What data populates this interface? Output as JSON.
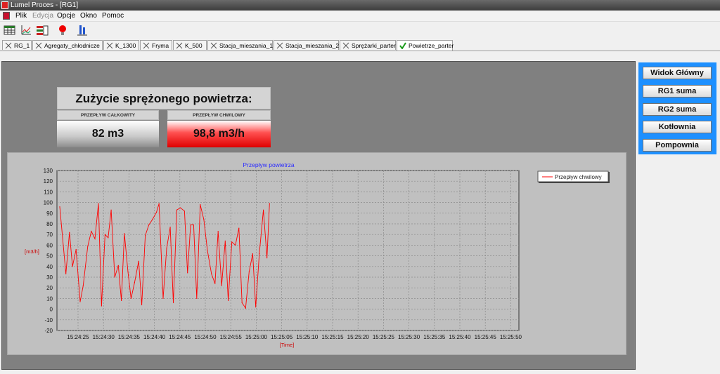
{
  "window": {
    "title": "Lumel Proces - [RG1]"
  },
  "menu": [
    {
      "label": "Plik",
      "disabled": false
    },
    {
      "label": "Edycja",
      "disabled": true
    },
    {
      "label": "Opcje",
      "disabled": false
    },
    {
      "label": "Okno",
      "disabled": false
    },
    {
      "label": "Pomoc",
      "disabled": false
    }
  ],
  "toolbar": [
    "table-icon",
    "chart-icon",
    "list-icon",
    "alarm-lamp-icon",
    "export-icon"
  ],
  "tabs": [
    {
      "label": "RG_1",
      "active": false
    },
    {
      "label": "Agregaty_chłodnicze",
      "active": false
    },
    {
      "label": "K_1300",
      "active": false
    },
    {
      "label": "Fryma",
      "active": false
    },
    {
      "label": "K_500",
      "active": false
    },
    {
      "label": "Stacja_mieszania_1",
      "active": false
    },
    {
      "label": "Stacja_mieszania_2",
      "active": false
    },
    {
      "label": "Sprężarki_parter",
      "active": false
    },
    {
      "label": "Powietrze_parter",
      "active": true
    }
  ],
  "consumption": {
    "title": "Zużycie sprężonego powietrza:",
    "total_label": "PRZEPŁYW CAŁKOWITY",
    "total_value": "82 m3",
    "instant_label": "PRZEPŁYW CHWILOWY",
    "instant_value": "98,8 m3/h",
    "instant_color": "#ff0000"
  },
  "nav_buttons": [
    "Widok Główny",
    "RG1 suma",
    "RG2 suma",
    "Kotłownia",
    "Pompownia"
  ],
  "chart_data": {
    "type": "line",
    "title": "Przepływ powietrza",
    "xlabel": "[Time]",
    "ylabel": "[m3/h]",
    "ylim": [
      -20,
      130
    ],
    "yticks": [
      -20,
      -10,
      0,
      10,
      20,
      30,
      40,
      50,
      60,
      70,
      80,
      90,
      100,
      110,
      120,
      130
    ],
    "xlim_seconds": [
      0,
      60
    ],
    "xticks": [
      "15:24:25",
      "15:24:30",
      "15:24:35",
      "15:24:40",
      "15:24:45",
      "15:24:50",
      "15:24:55",
      "15:25:00",
      "15:25:05",
      "15:25:10",
      "15:25:15",
      "15:25:20",
      "15:25:25",
      "15:25:30",
      "15:25:35",
      "15:25:40",
      "15:25:45",
      "15:25:50"
    ],
    "grid": true,
    "legend_position": "right",
    "series": [
      {
        "name": "Przepływ chwilowy",
        "color": "#ff0000",
        "points": [
          [
            0.0,
            96
          ],
          [
            1.2,
            33
          ],
          [
            1.9,
            72
          ],
          [
            2.5,
            40
          ],
          [
            3.2,
            56
          ],
          [
            4.0,
            7
          ],
          [
            4.6,
            22
          ],
          [
            5.5,
            59
          ],
          [
            6.2,
            73
          ],
          [
            6.9,
            66
          ],
          [
            7.6,
            99
          ],
          [
            8.2,
            3
          ],
          [
            8.9,
            70
          ],
          [
            9.5,
            67
          ],
          [
            10.1,
            93
          ],
          [
            10.8,
            30
          ],
          [
            11.5,
            41
          ],
          [
            12.1,
            8
          ],
          [
            12.7,
            71
          ],
          [
            13.4,
            35
          ],
          [
            14.0,
            10
          ],
          [
            14.7,
            25
          ],
          [
            15.5,
            45
          ],
          [
            16.1,
            4
          ],
          [
            16.8,
            69
          ],
          [
            17.5,
            79
          ],
          [
            18.2,
            84
          ],
          [
            19.0,
            91
          ],
          [
            19.5,
            99
          ],
          [
            20.3,
            10
          ],
          [
            21.0,
            57
          ],
          [
            21.7,
            77
          ],
          [
            22.3,
            6
          ],
          [
            23.0,
            93
          ],
          [
            23.7,
            95
          ],
          [
            24.5,
            92
          ],
          [
            25.1,
            34
          ],
          [
            25.7,
            79
          ],
          [
            26.3,
            79
          ],
          [
            26.9,
            10
          ],
          [
            27.6,
            98
          ],
          [
            28.3,
            84
          ],
          [
            29.0,
            55
          ],
          [
            29.8,
            33
          ],
          [
            30.5,
            24
          ],
          [
            31.1,
            73
          ],
          [
            31.8,
            22
          ],
          [
            32.5,
            64
          ],
          [
            33.1,
            8
          ],
          [
            33.8,
            63
          ],
          [
            34.5,
            60
          ],
          [
            35.2,
            76
          ],
          [
            35.8,
            6
          ],
          [
            36.5,
            1
          ],
          [
            37.2,
            35
          ],
          [
            37.9,
            52
          ],
          [
            38.5,
            2
          ],
          [
            39.2,
            52
          ],
          [
            40.0,
            93
          ],
          [
            40.7,
            48
          ],
          [
            41.2,
            99
          ]
        ]
      }
    ]
  }
}
